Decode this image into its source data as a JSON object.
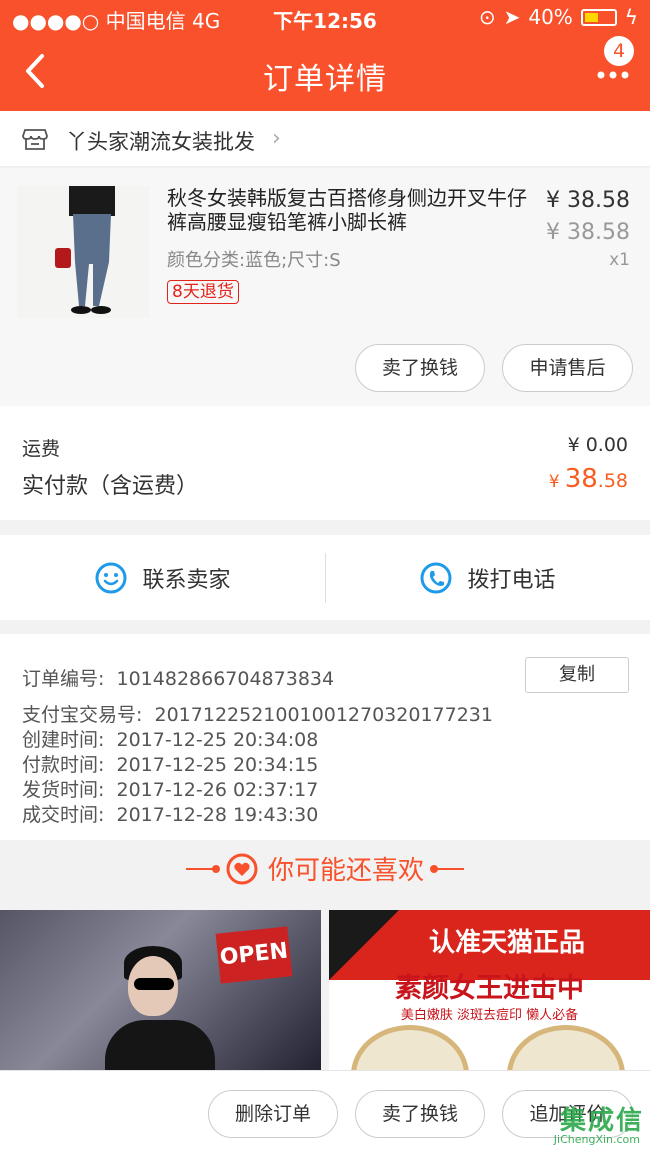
{
  "status_bar": {
    "carrier": "●●●●○ 中国电信  4G",
    "time": "下午12:56",
    "battery": "40%"
  },
  "nav": {
    "title": "订单详情",
    "badge": "4"
  },
  "shop": {
    "name": "丫头家潮流女装批发"
  },
  "product": {
    "name": "秋冬女装韩版复古百搭修身侧边开叉牛仔裤高腰显瘦铅笔裤小脚长裤",
    "attributes": "颜色分类:蓝色;尺寸:S",
    "return_tag": "8天退货",
    "price": "¥ 38.58",
    "original_price": "¥ 38.58",
    "quantity": "x1",
    "actions": [
      "卖了换钱",
      "申请售后"
    ]
  },
  "fees": {
    "shipping_label": "运费",
    "shipping_value": "¥ 0.00",
    "paid_label": "实付款（含运费）",
    "paid_currency": "¥",
    "paid_integer": "38",
    "paid_decimal": ".58"
  },
  "contact": {
    "seller": "联系卖家",
    "call": "拨打电话"
  },
  "order_info": {
    "copy_label": "复制",
    "rows": [
      {
        "label": "订单编号:",
        "value": "101482866704873834"
      },
      {
        "label": "支付宝交易号:",
        "value": "2017122521001001270320177231"
      },
      {
        "label": "创建时间:",
        "value": "2017-12-25 20:34:08"
      },
      {
        "label": "付款时间:",
        "value": "2017-12-25 20:34:15"
      },
      {
        "label": "发货时间:",
        "value": "2017-12-26 02:37:17"
      },
      {
        "label": "成交时间:",
        "value": "2017-12-28 19:43:30"
      }
    ]
  },
  "recommend": {
    "title": "你可能还喜欢",
    "card1_sign": "OPEN",
    "card2_banner": "认准天猫正品",
    "card2_title": "素颜女王进击中",
    "card2_sub": "美白嫩肤  淡斑去痘印  懒人必备"
  },
  "bottom_actions": [
    "删除订单",
    "卖了换钱",
    "追加评价"
  ],
  "watermark": {
    "text": "集成信",
    "sub": "JiChengXin.com"
  },
  "colors": {
    "accent": "#f8512c",
    "price_accent": "#f85c1e",
    "tag_red": "#e2231a"
  }
}
